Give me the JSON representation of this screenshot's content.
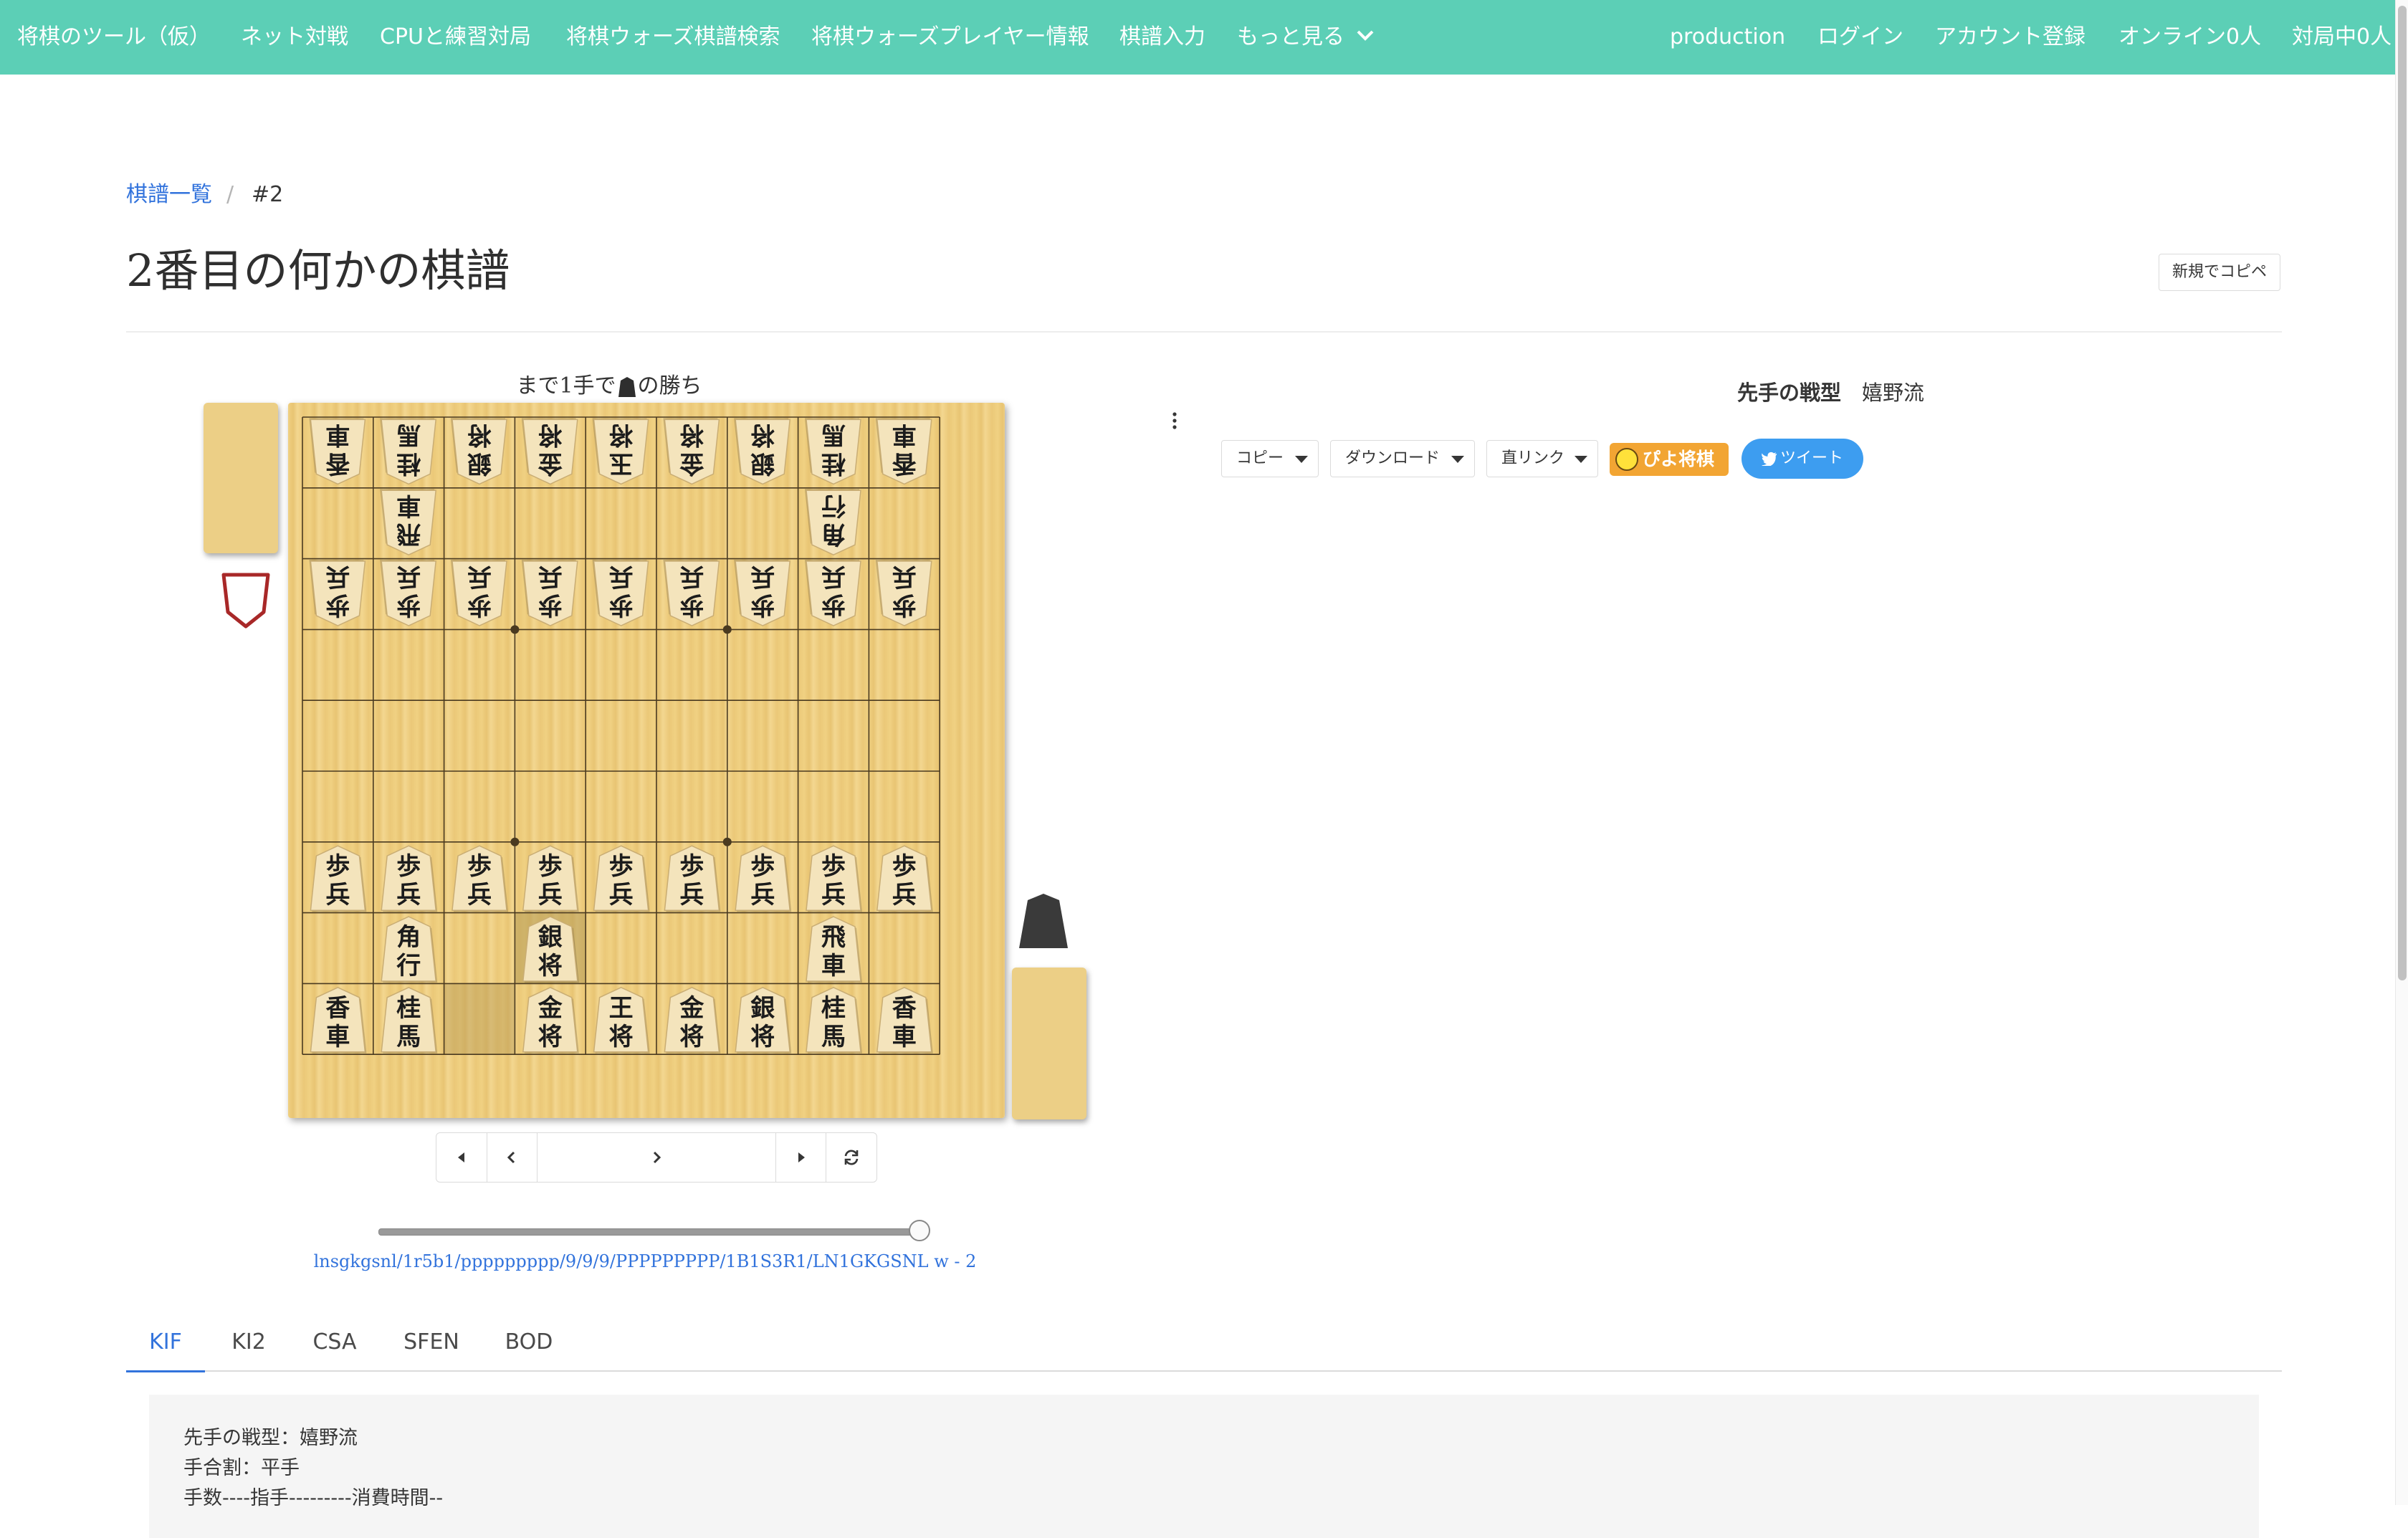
{
  "navbar": {
    "brand": "将棋のツール（仮）",
    "items": [
      "ネット対戦",
      "CPUと練習対局",
      "将棋ウォーズ棋譜検索",
      "将棋ウォーズプレイヤー情報",
      "棋譜入力",
      "もっと見る"
    ],
    "right_items": [
      "production",
      "ログイン",
      "アカウント登録",
      "オンライン0人",
      "対局中0人"
    ]
  },
  "breadcrumb": {
    "link": "棋譜一覧",
    "separator": "/",
    "current": "#2"
  },
  "page_title": "2番目の何かの棋譜",
  "copy_new_button": "新規でコピペ",
  "board": {
    "status_before": "まで1手で",
    "status_after": "の勝ち",
    "gote_rows": [
      [
        "香車",
        "桂馬",
        "銀将",
        "金将",
        "玉将",
        "金将",
        "銀将",
        "桂馬",
        "香車"
      ],
      [
        "",
        "飛車",
        "",
        "",
        "",
        "",
        "",
        "角行",
        ""
      ],
      [
        "歩兵",
        "歩兵",
        "歩兵",
        "歩兵",
        "歩兵",
        "歩兵",
        "歩兵",
        "歩兵",
        "歩兵"
      ]
    ],
    "sente_rows": [
      [
        "歩兵",
        "歩兵",
        "歩兵",
        "歩兵",
        "歩兵",
        "歩兵",
        "歩兵",
        "歩兵",
        "歩兵"
      ],
      [
        "",
        "角行",
        "",
        "銀将",
        "",
        "",
        "",
        "飛車",
        ""
      ],
      [
        "香車",
        "桂馬",
        "",
        "金将",
        "王将",
        "金将",
        "銀将",
        "桂馬",
        "香車"
      ]
    ],
    "position_progress": 1.0,
    "sfen": "lnsgkgsnl/1r5b1/ppppppppp/9/9/9/PPPPPPPPP/1B1S3R1/LN1GKGSNL w - 2"
  },
  "side_panel": {
    "strategy_label": "先手の戦型",
    "strategy_value": "嬉野流",
    "buttons": {
      "copy": "コピー",
      "download": "ダウンロード",
      "direct_link": "直リンク",
      "piyo": "ぴよ将棋",
      "tweet": "ツイート"
    }
  },
  "tabs": [
    "KIF",
    "KI2",
    "CSA",
    "SFEN",
    "BOD"
  ],
  "kif_lines": [
    "先手の戦型：嬉野流",
    "手合割：平手",
    "手数----指手---------消費時間--"
  ],
  "colors": {
    "navbar": "#5ccfb6",
    "link": "#3273dc",
    "board": "#eccf86",
    "piyo": "#f2a533",
    "tweet": "#3d9df0"
  }
}
